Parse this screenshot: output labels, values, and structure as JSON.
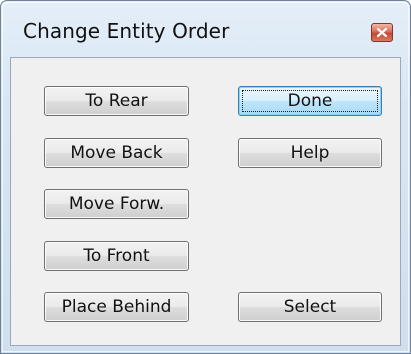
{
  "window": {
    "title": "Change Entity Order",
    "close_icon": "close-icon"
  },
  "buttons": {
    "to_rear": "To Rear",
    "move_back": "Move Back",
    "move_forward": "Move Forw.",
    "to_front": "To Front",
    "place_behind": "Place Behind",
    "done": "Done",
    "help": "Help",
    "select": "Select"
  },
  "colors": {
    "close_button": "#c44a34",
    "default_button_border": "#3c7fb1"
  }
}
